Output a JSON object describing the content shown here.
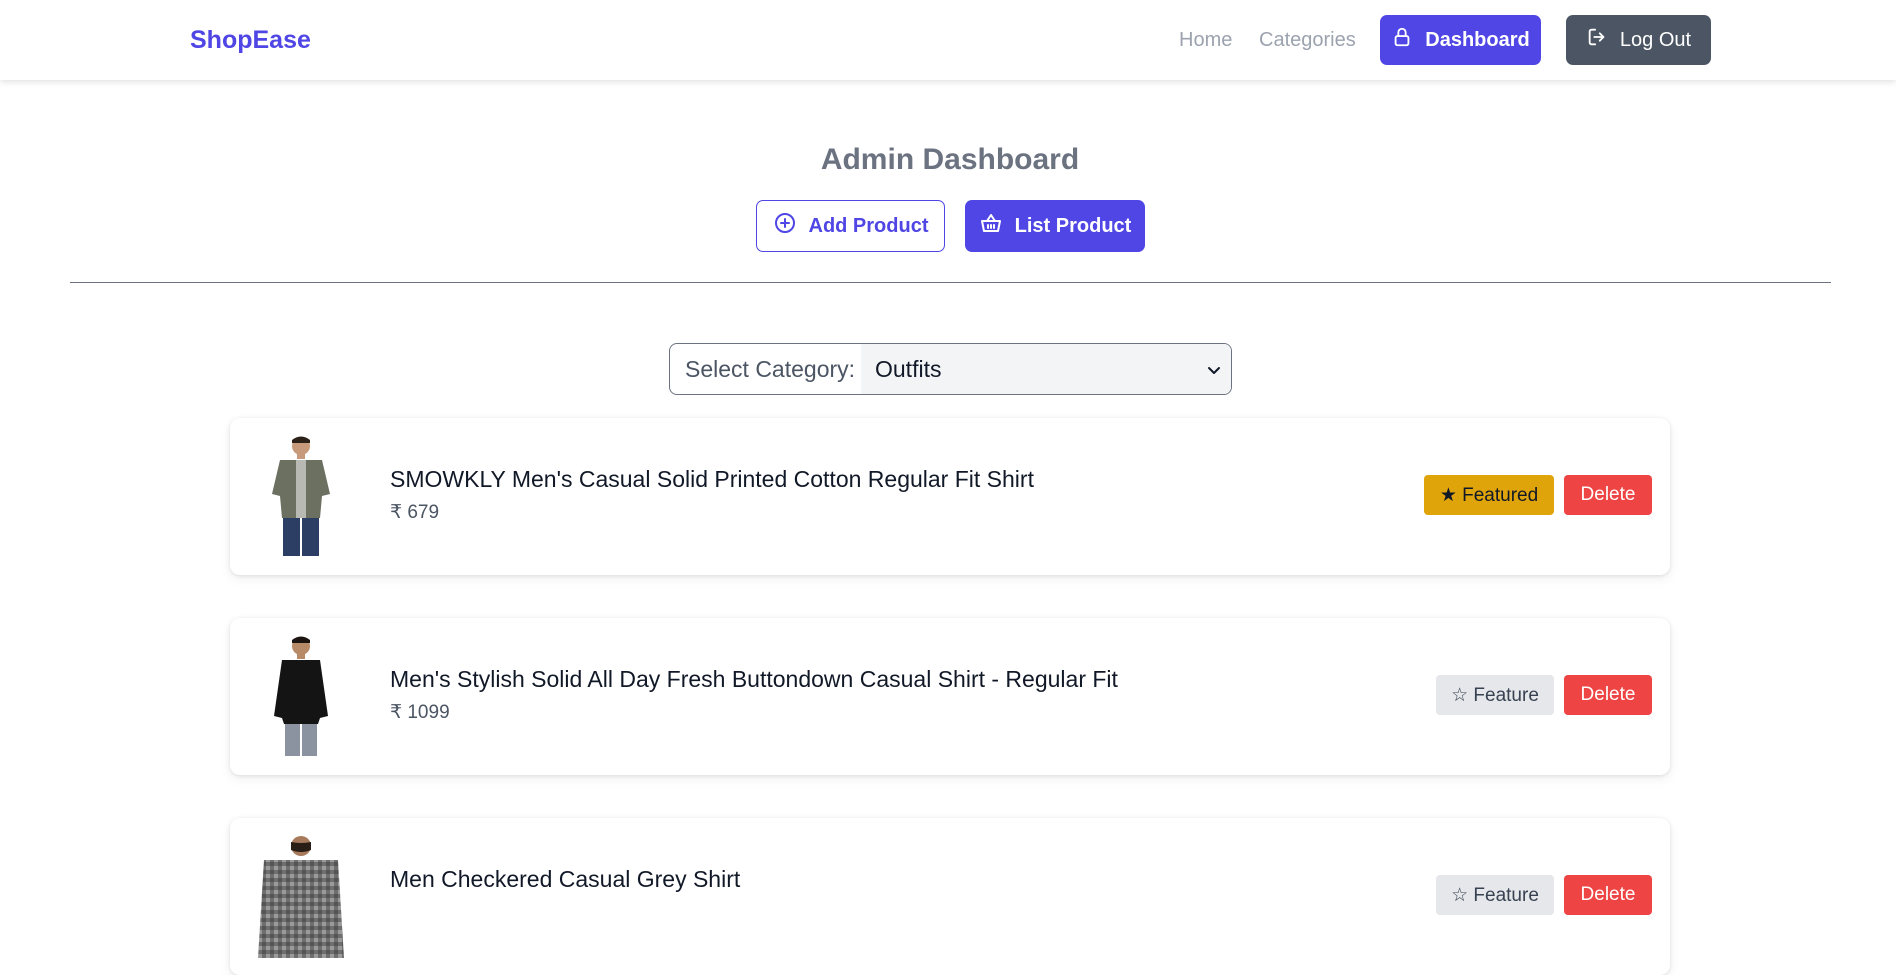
{
  "navbar": {
    "brand": "ShopEase",
    "home": "Home",
    "categories": "Categories",
    "dashboard": "Dashboard",
    "logout": "Log Out"
  },
  "header": {
    "title": "Admin Dashboard",
    "add_product": "Add Product",
    "list_product": "List Product"
  },
  "filter": {
    "label": "Select Category:",
    "selected": "Outfits"
  },
  "products": [
    {
      "name": "SMOWKLY Men's Casual Solid Printed Cotton Regular Fit Shirt",
      "price": "₹ 679",
      "feature_label": "★ Featured",
      "featured": true,
      "delete_label": "Delete"
    },
    {
      "name": "Men's Stylish Solid All Day Fresh Buttondown Casual Shirt - Regular Fit",
      "price": "₹ 1099",
      "feature_label": "☆ Feature",
      "featured": false,
      "delete_label": "Delete"
    },
    {
      "name": "Men Checkered Casual Grey Shirt",
      "price": "",
      "feature_label": "☆ Feature",
      "featured": false,
      "delete_label": "Delete"
    }
  ],
  "colors": {
    "primary": "#4f46e5",
    "logout": "#4b5563",
    "featured": "#e0a40b",
    "delete": "#ef4444"
  }
}
